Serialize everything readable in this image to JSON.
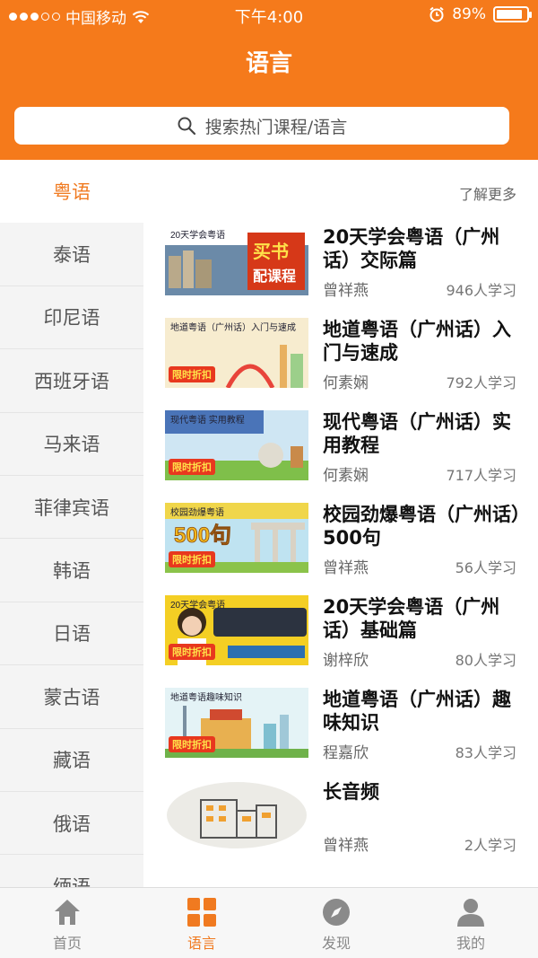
{
  "status_bar": {
    "carrier": "中国移动",
    "time": "下午4:00",
    "battery": "89%",
    "battery_level": 0.89
  },
  "header": {
    "title": "语言",
    "search_placeholder": "搜索热门课程/语言"
  },
  "sidebar": {
    "items": [
      {
        "label": "粤语",
        "active": true
      },
      {
        "label": "泰语"
      },
      {
        "label": "印尼语"
      },
      {
        "label": "西班牙语"
      },
      {
        "label": "马来语"
      },
      {
        "label": "菲律宾语"
      },
      {
        "label": "韩语"
      },
      {
        "label": "日语"
      },
      {
        "label": "蒙古语"
      },
      {
        "label": "藏语"
      },
      {
        "label": "俄语"
      },
      {
        "label": "缅语"
      }
    ]
  },
  "content": {
    "more_label": "了解更多",
    "courses": [
      {
        "title": "20天学会粤语（广州话）交际篇",
        "teacher": "曾祥燕",
        "learners": "946人学习",
        "thumb": {
          "line1": "20天学会粤语",
          "badge_line1": "买书",
          "badge_line2": "配课程"
        }
      },
      {
        "title": "地道粤语（广州话）入门与速成",
        "teacher": "何素娴",
        "learners": "792人学习",
        "thumb": {
          "line1": "地道粤语（广州话）入门与速成",
          "sale": "限时折扣"
        }
      },
      {
        "title": "现代粤语（广州话）实用教程",
        "teacher": "何素娴",
        "learners": "717人学习",
        "thumb": {
          "line1": "现代粤语 实用教程",
          "sale": "限时折扣"
        }
      },
      {
        "title": "校园劲爆粤语（广州话）500句",
        "teacher": "曾祥燕",
        "learners": "56人学习",
        "thumb": {
          "line1": "校园劲爆粤语",
          "big": "500句",
          "sale": "限时折扣"
        }
      },
      {
        "title": "20天学会粤语（广州话）基础篇",
        "teacher": "谢梓欣",
        "learners": "80人学习",
        "thumb": {
          "line1": "20天学会粤语",
          "sale": "限时折扣"
        }
      },
      {
        "title": "地道粤语（广州话）趣味知识",
        "teacher": "程嘉欣",
        "learners": "83人学习",
        "thumb": {
          "line1": "地道粤语趣味知识",
          "sale": "限时折扣"
        }
      },
      {
        "title": "长音频",
        "teacher": "曾祥燕",
        "learners": "2人学习",
        "thumb": {}
      }
    ]
  },
  "tabbar": {
    "items": [
      {
        "label": "首页",
        "icon": "home-icon"
      },
      {
        "label": "语言",
        "icon": "grid-icon",
        "active": true
      },
      {
        "label": "发现",
        "icon": "compass-icon"
      },
      {
        "label": "我的",
        "icon": "person-icon"
      }
    ]
  },
  "colors": {
    "brand": "#f57a1b",
    "accent": "#f07a20"
  }
}
